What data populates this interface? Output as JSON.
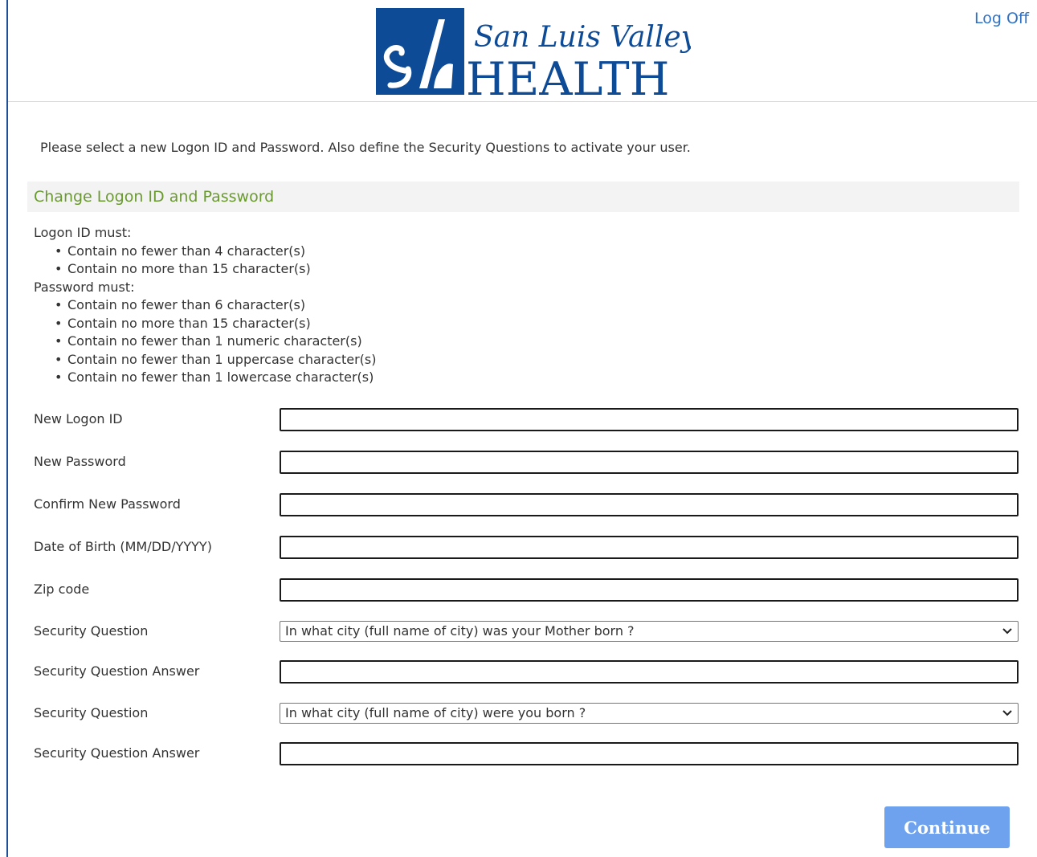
{
  "header": {
    "logo_text_top": "San Luis Valley",
    "logo_text_bottom": "HEALTH",
    "logo_colors": {
      "brand_blue": "#0e4b97"
    },
    "logoff_label": "Log Off"
  },
  "intro_text": "Please select a new Logon ID and Password. Also define the Security Questions to activate your user.",
  "section_title": "Change Logon ID and Password",
  "rules": {
    "logon_heading": "Logon ID must:",
    "logon_items": [
      "Contain no fewer than 4 character(s)",
      "Contain no more than 15 character(s)"
    ],
    "password_heading": "Password must:",
    "password_items": [
      "Contain no fewer than 6 character(s)",
      "Contain no more than 15 character(s)",
      "Contain no fewer than 1 numeric character(s)",
      "Contain no fewer than 1 uppercase character(s)",
      "Contain no fewer than 1 lowercase character(s)"
    ]
  },
  "form": {
    "new_logon_id": {
      "label": "New Logon ID",
      "value": ""
    },
    "new_password": {
      "label": "New Password",
      "value": ""
    },
    "confirm_password": {
      "label": "Confirm New Password",
      "value": ""
    },
    "dob": {
      "label": "Date of Birth (MM/DD/YYYY)",
      "value": ""
    },
    "zip": {
      "label": "Zip code",
      "value": ""
    },
    "security_question_1": {
      "label": "Security Question",
      "selected": "In what city (full name of city) was your Mother born ?"
    },
    "security_answer_1": {
      "label": "Security Question Answer",
      "value": ""
    },
    "security_question_2": {
      "label": "Security Question",
      "selected": "In what city (full name of city) were you born ?"
    },
    "security_answer_2": {
      "label": "Security Question Answer",
      "value": ""
    }
  },
  "continue_label": "Continue",
  "colors": {
    "accent_green": "#6a9a2f",
    "link_blue": "#2e72c8",
    "button_blue": "#6ea2ee"
  }
}
